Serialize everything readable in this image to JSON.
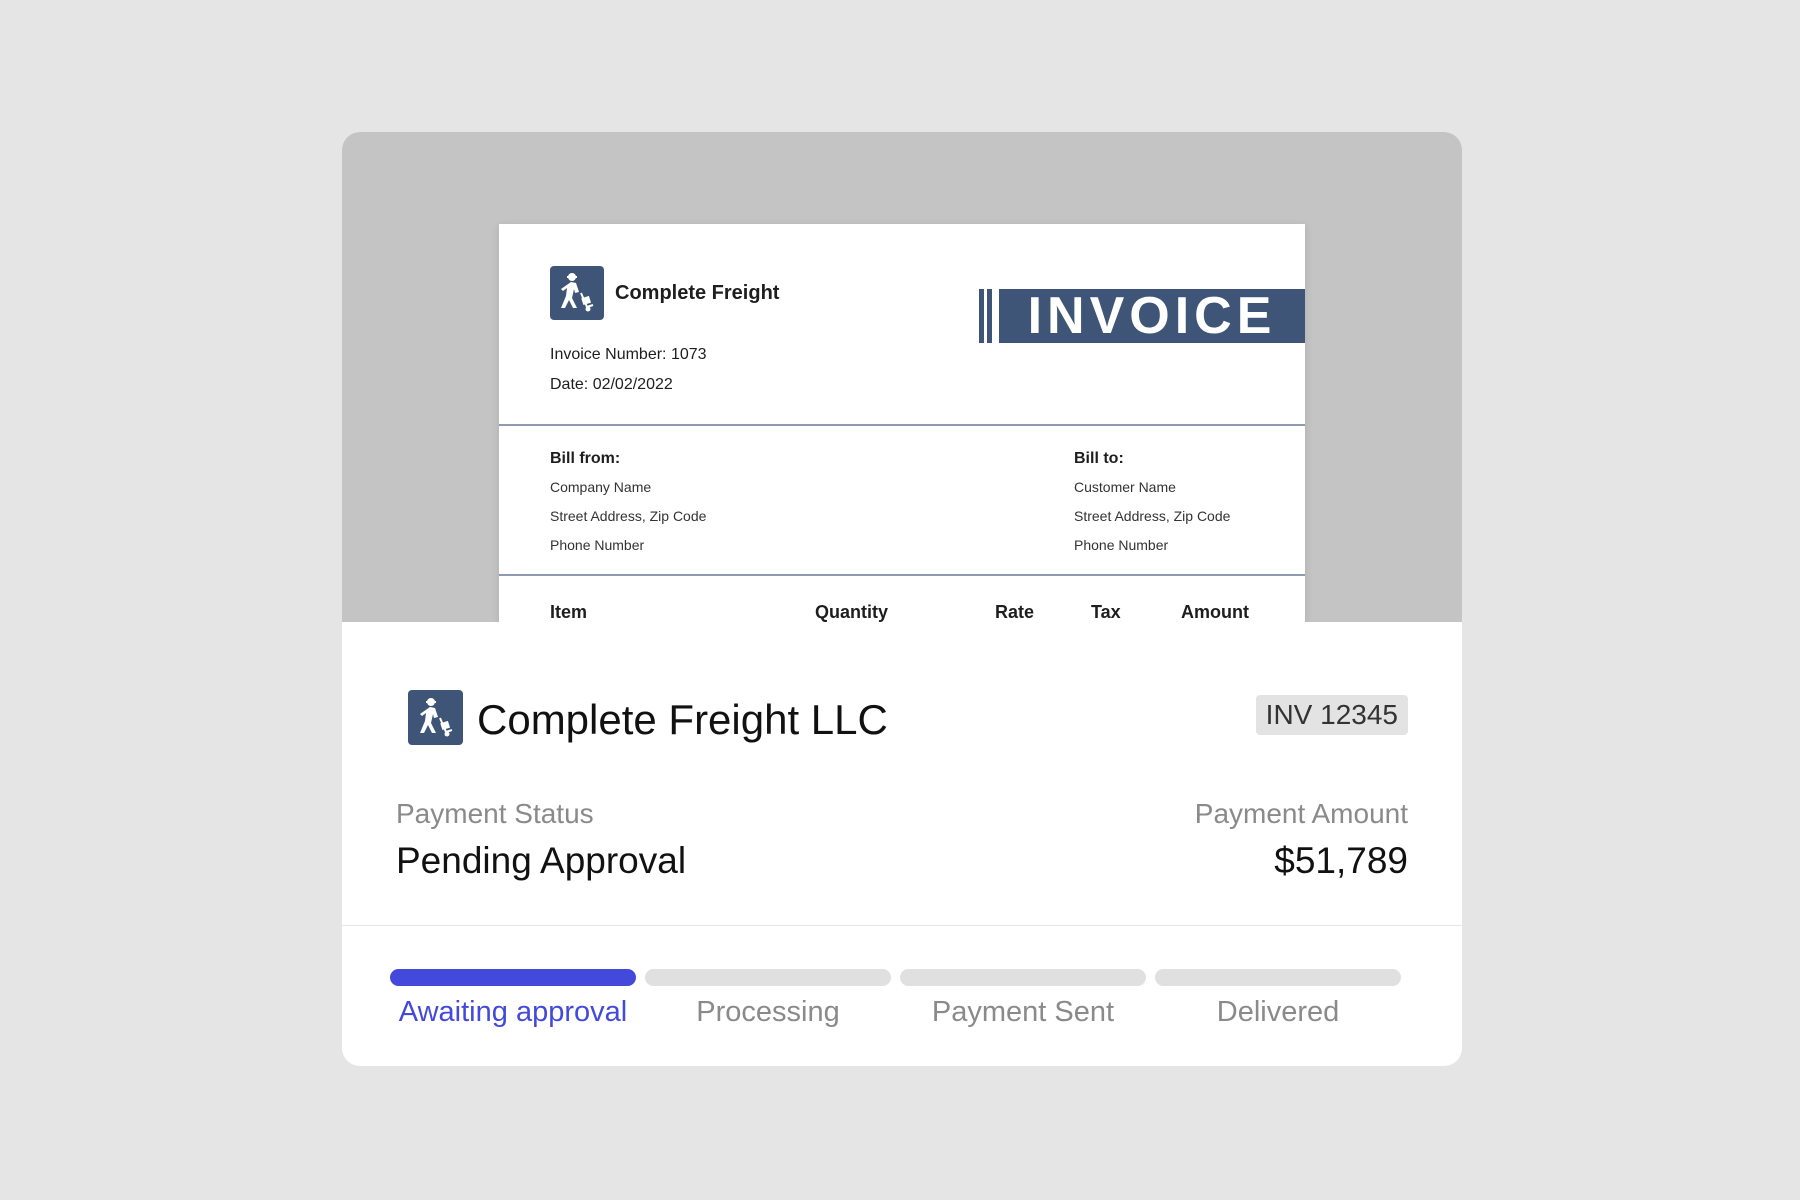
{
  "invoice_preview": {
    "company": "Complete Freight",
    "banner": "INVOICE",
    "invoice_number": "Invoice Number: 1073",
    "date": "Date: 02/02/2022",
    "bill_from": {
      "heading": "Bill from:",
      "lines": [
        "Company Name",
        "Street Address, Zip Code",
        "Phone Number"
      ]
    },
    "bill_to": {
      "heading": "Bill to:",
      "lines": [
        "Customer Name",
        "Street Address, Zip Code",
        "Phone Number"
      ]
    },
    "columns": [
      "Item",
      "Quantity",
      "Rate",
      "Tax",
      "Amount"
    ]
  },
  "summary": {
    "company": "Complete Freight LLC",
    "invoice_id": "INV 12345",
    "status_label": "Payment Status",
    "status_value": "Pending Approval",
    "amount_label": "Payment Amount",
    "amount_value": "$51,789"
  },
  "progress": {
    "current_step": 1,
    "steps": [
      {
        "label": "Awaiting approval",
        "active": true
      },
      {
        "label": "Processing",
        "active": false
      },
      {
        "label": "Payment Sent",
        "active": false
      },
      {
        "label": "Delivered",
        "active": false
      }
    ]
  },
  "colors": {
    "brand": "#3f5577",
    "accent": "#4349db",
    "inactive_bar": "#e0e0e0",
    "inactive_text": "#8a8a8a"
  },
  "icons": {
    "logo": "delivery-worker-dolly-icon"
  }
}
